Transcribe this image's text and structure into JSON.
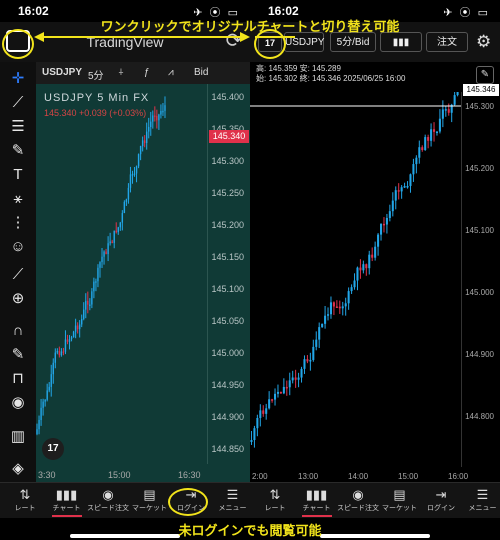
{
  "annotation_top": "ワンクリックでオリジナルチャートと切り替え可能",
  "annotation_bottom": "未ログインでも閲覧可能",
  "left": {
    "time": "16:02",
    "status_icons": "✈ ⦿ ▭",
    "title": "TradingView",
    "chart_header": {
      "symbol": "USDJPY",
      "interval": "5分",
      "bid": "Bid"
    },
    "symbol_line": "USDJPY  5  Min FX",
    "ohlc_line": "145.340 +0.039 (+0.03%)",
    "price_ticks": [
      "145.400",
      "145.350",
      "145.300",
      "145.250",
      "145.200",
      "145.150",
      "145.100",
      "145.050",
      "145.000",
      "144.950",
      "144.900",
      "144.850"
    ],
    "last_price": "145.340",
    "x_labels": [
      "3:30",
      "15:00",
      "16:30"
    ],
    "nav": [
      {
        "label": "レート",
        "icon": "⇅"
      },
      {
        "label": "チャート",
        "icon": "▮▮▮"
      },
      {
        "label": "スピード注文",
        "icon": "◉"
      },
      {
        "label": "マーケット",
        "icon": "▤"
      },
      {
        "label": "ログイン",
        "icon": "⇥"
      },
      {
        "label": "メニュー",
        "icon": "☰"
      }
    ]
  },
  "right": {
    "time": "16:02",
    "status_icons": "✈ ⦿ ▭",
    "symbol_button": "USDJPY",
    "interval_button": "5分/Bid",
    "order_button": "注文",
    "info_line1": "高: 145.359 安: 145.289",
    "info_line2": "始: 145.302 終: 145.346  2025/06/25 16:00",
    "price_ticks": [
      "145.300",
      "145.200",
      "145.100",
      "145.000",
      "144.900",
      "144.800"
    ],
    "last_price": "145.346",
    "x_labels": [
      "2:00",
      "13:00",
      "14:00",
      "15:00",
      "16:00"
    ],
    "nav": [
      {
        "label": "レート",
        "icon": "⇅"
      },
      {
        "label": "チャート",
        "icon": "▮▮▮"
      },
      {
        "label": "スピード注文",
        "icon": "◉"
      },
      {
        "label": "マーケット",
        "icon": "▤"
      },
      {
        "label": "ログイン",
        "icon": "⇥"
      },
      {
        "label": "メニュー",
        "icon": "☰"
      }
    ]
  },
  "colors": {
    "up": "#22a6e8",
    "down": "#e0314b",
    "annotation": "#f2e41b",
    "left_bg": "#103a36"
  }
}
